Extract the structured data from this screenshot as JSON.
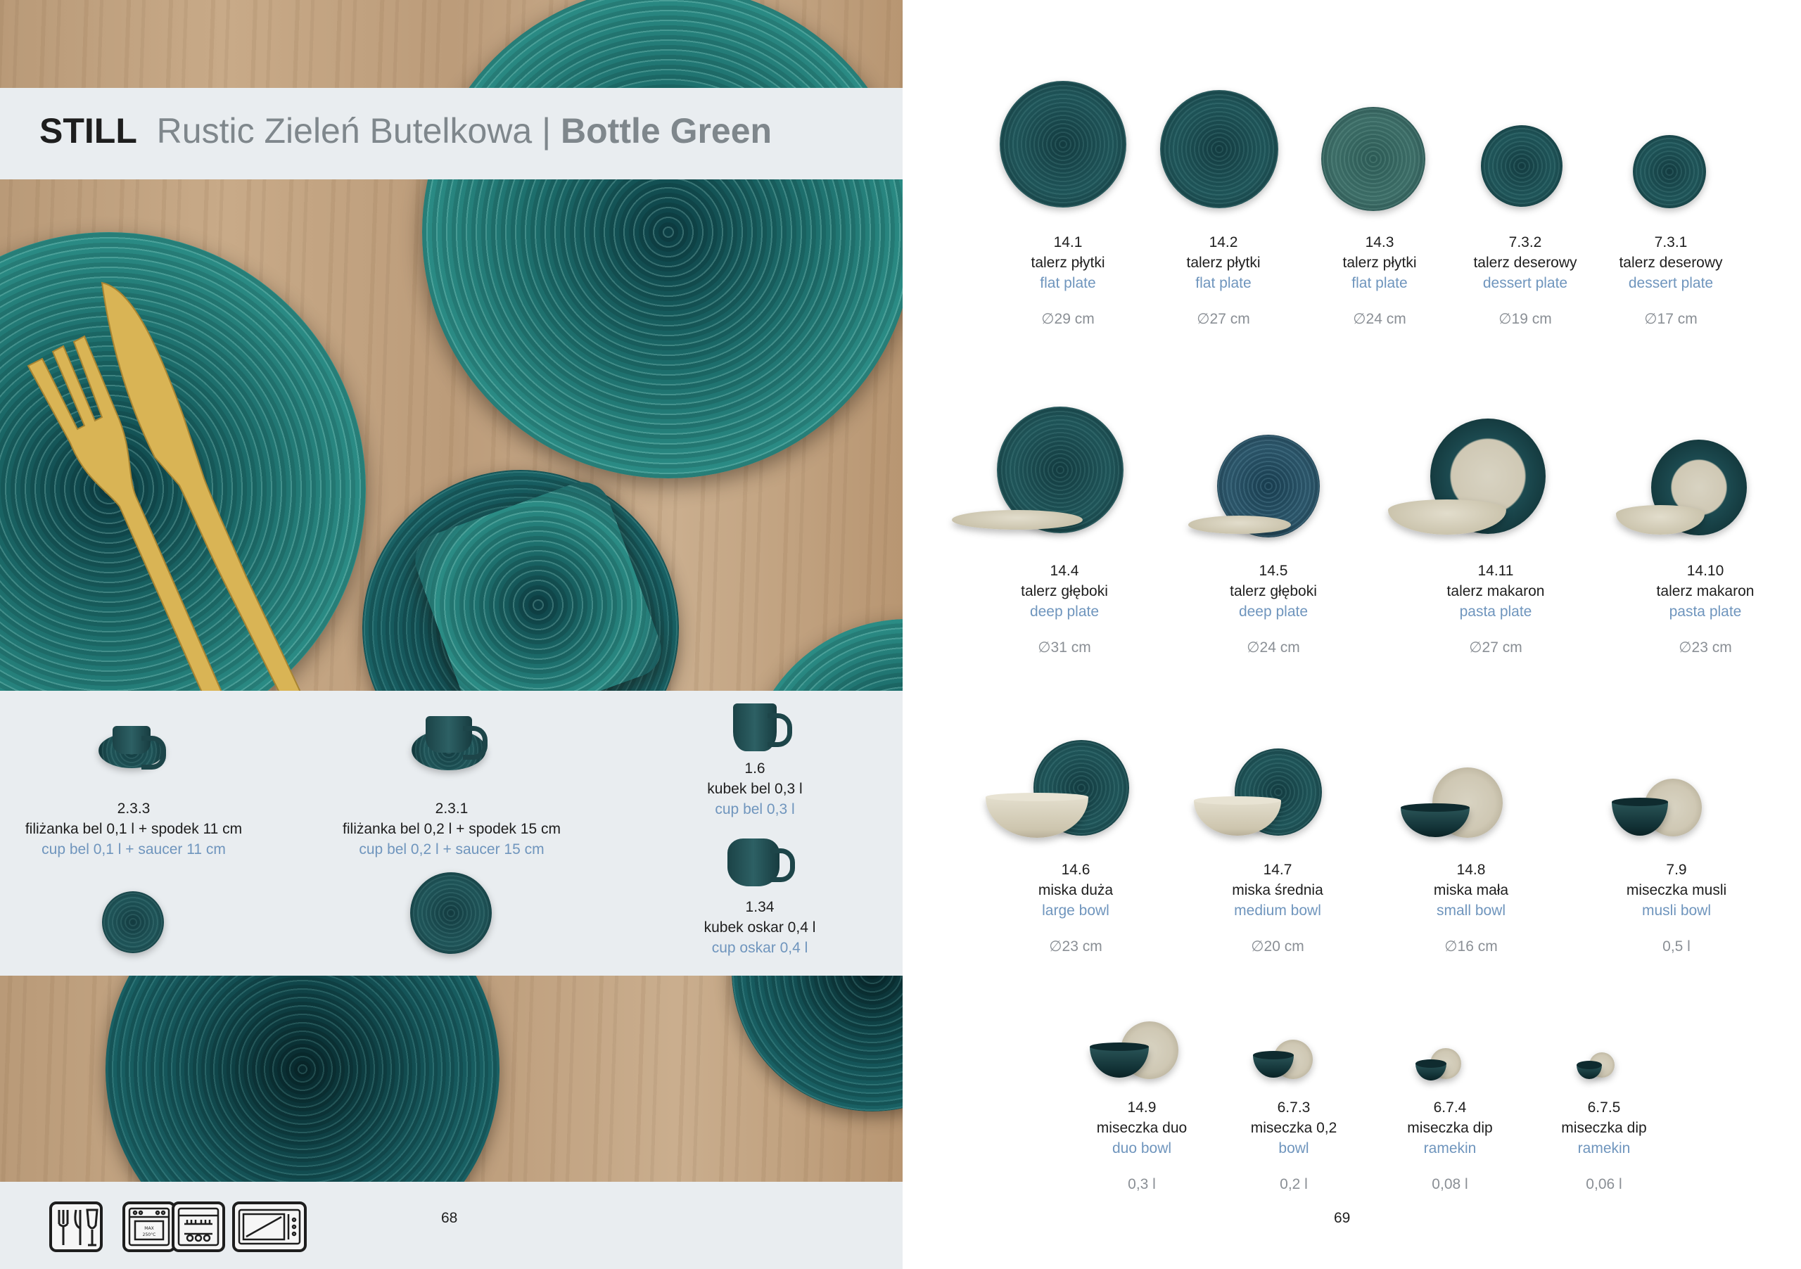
{
  "header": {
    "brand": "STILL",
    "series": "Rustic Zieleń Butelkowa |",
    "color_en": "Bottle Green"
  },
  "left_items": [
    {
      "code": "2.3.3",
      "pl": "filiżanka bel 0,1 l + spodek 11 cm",
      "en": "cup bel 0,1 l + saucer 11 cm"
    },
    {
      "code": "2.3.1",
      "pl": "filiżanka bel 0,2 l + spodek 15 cm",
      "en": "cup bel 0,2 l + saucer 15 cm"
    },
    {
      "code": "1.6",
      "pl": "kubek bel 0,3 l",
      "en": "cup bel 0,3 l"
    },
    {
      "code": "1.34",
      "pl": "kubek oskar 0,4 l",
      "en": "cup oskar 0,4 l"
    }
  ],
  "care_icons": [
    "fork-knife-glass-icon",
    "oven-icon",
    "dishwasher-icon",
    "microwave-icon"
  ],
  "page_left_number": "68",
  "page_right_number": "69",
  "rows": [
    [
      {
        "code": "14.1",
        "pl": "talerz płytki",
        "en": "flat plate",
        "size": "∅29 cm"
      },
      {
        "code": "14.2",
        "pl": "talerz płytki",
        "en": "flat plate",
        "size": "∅27 cm"
      },
      {
        "code": "14.3",
        "pl": "talerz płytki",
        "en": "flat plate",
        "size": "∅24 cm"
      },
      {
        "code": "7.3.2",
        "pl": "talerz deserowy",
        "en": "dessert plate",
        "size": "∅19 cm"
      },
      {
        "code": "7.3.1",
        "pl": "talerz deserowy",
        "en": "dessert plate",
        "size": "∅17 cm"
      }
    ],
    [
      {
        "code": "14.4",
        "pl": "talerz głęboki",
        "en": "deep plate",
        "size": "∅31 cm"
      },
      {
        "code": "14.5",
        "pl": "talerz głęboki",
        "en": "deep plate",
        "size": "∅24 cm"
      },
      {
        "code": "14.11",
        "pl": "talerz makaron",
        "en": "pasta plate",
        "size": "∅27 cm"
      },
      {
        "code": "14.10",
        "pl": "talerz makaron",
        "en": "pasta plate",
        "size": "∅23 cm"
      }
    ],
    [
      {
        "code": "14.6",
        "pl": "miska duża",
        "en": "large bowl",
        "size": "∅23 cm"
      },
      {
        "code": "14.7",
        "pl": "miska średnia",
        "en": "medium bowl",
        "size": "∅20 cm"
      },
      {
        "code": "14.8",
        "pl": "miska mała",
        "en": "small bowl",
        "size": "∅16 cm"
      },
      {
        "code": "7.9",
        "pl": "miseczka musli",
        "en": "musli bowl",
        "size": "0,5 l"
      }
    ],
    [
      {
        "code": "14.9",
        "pl": "miseczka duo",
        "en": "duo bowl",
        "size": "0,3 l"
      },
      {
        "code": "6.7.3",
        "pl": "miseczka 0,2",
        "en": "bowl",
        "size": "0,2 l"
      },
      {
        "code": "6.7.4",
        "pl": "miseczka dip",
        "en": "ramekin",
        "size": "0,08 l"
      },
      {
        "code": "6.7.5",
        "pl": "miseczka dip",
        "en": "ramekin",
        "size": "0,06 l"
      }
    ]
  ],
  "colors": {
    "label_en": "#6f95bd",
    "band": "#e9edf0",
    "glaze": "#1d5c5e"
  }
}
